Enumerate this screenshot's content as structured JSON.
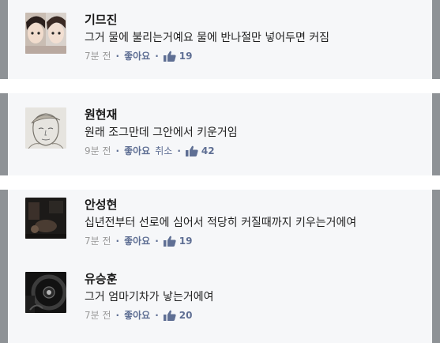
{
  "comments": [
    {
      "author": "기므진",
      "text": "그거 물에 불리는거예요 물에 반나절만 넣어두면 커짐",
      "time": "7분 전",
      "like_label": "좋아요",
      "like_count": "19",
      "avatar_icon": "two-person-photo"
    },
    {
      "author": "원현재",
      "text": "원래 조그만데 그안에서 키운거임",
      "time": "9분 전",
      "like_label": "좋아요",
      "cancel_label": "취소",
      "like_count": "42",
      "avatar_icon": "sketch-portrait"
    },
    {
      "author": "안성현",
      "text": "십년전부터 선로에 심어서 적당히 커질때까지 키우는거에여",
      "time": "7분 전",
      "like_label": "좋아요",
      "like_count": "19",
      "avatar_icon": "dark-room-photo"
    },
    {
      "author": "유승훈",
      "text": "그거 엄마기차가 낳는거에여",
      "time": "7분 전",
      "like_label": "좋아요",
      "like_count": "20",
      "avatar_icon": "steering-wheel-photo"
    }
  ],
  "colors": {
    "card_bg": "#f6f7f9",
    "card_border": "#8e9296",
    "link": "#5f6f94",
    "meta_text": "#9a9a9a"
  }
}
